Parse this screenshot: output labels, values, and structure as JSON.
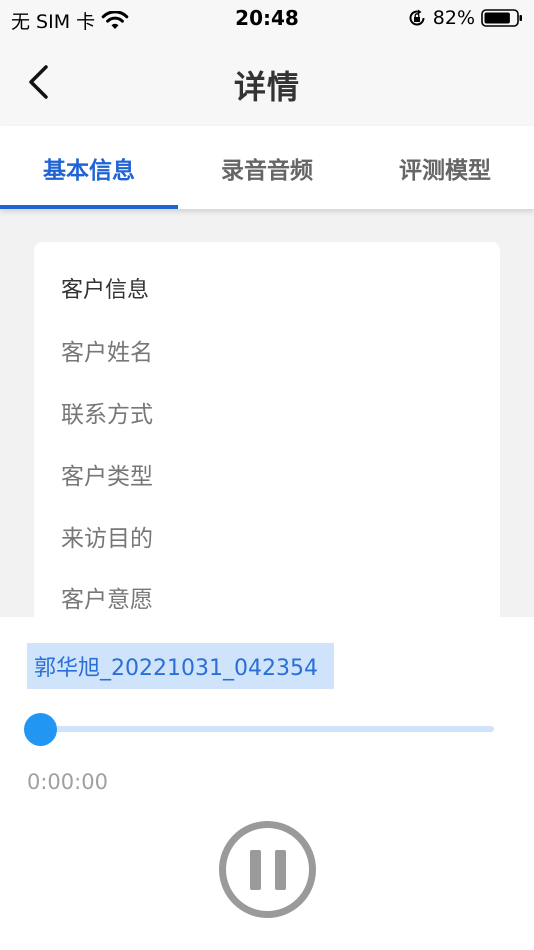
{
  "status_bar": {
    "carrier": "无 SIM 卡",
    "time": "20:48",
    "battery_percent": "82%",
    "battery_level": 0.82,
    "icons": [
      "wifi-icon",
      "rotation-lock-icon",
      "battery-icon"
    ]
  },
  "header": {
    "title": "详情",
    "back_icon": "chevron-left-icon"
  },
  "tabs": [
    {
      "label": "基本信息",
      "active": true
    },
    {
      "label": "录音音频",
      "active": false
    },
    {
      "label": "评测模型",
      "active": false
    }
  ],
  "info_card": {
    "title": "客户信息",
    "fields": [
      "客户姓名",
      "联系方式",
      "客户类型",
      "来访目的",
      "客户意愿"
    ]
  },
  "player": {
    "file_name": "郭华旭_20221031_042354",
    "current_time": "0:00:00",
    "progress": 0,
    "state_icon": "pause-icon"
  },
  "colors": {
    "accent": "#1f63d5",
    "player_accent": "#2196f3",
    "selection_bg": "#cfe4fb",
    "content_bg": "#f2f2f2"
  }
}
